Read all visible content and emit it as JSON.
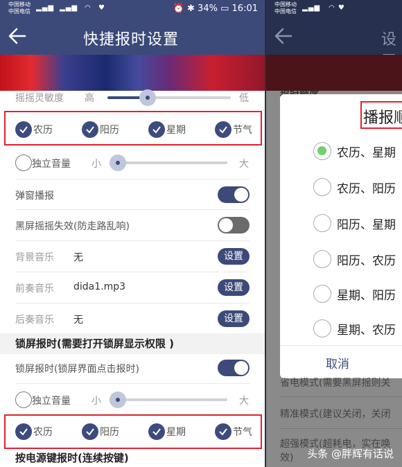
{
  "status_bar": {
    "carrier_top": "中国移动",
    "carrier_bottom": "中国电信",
    "net1": "2G",
    "net2": "4G",
    "battery": "34%",
    "time": "16:01"
  },
  "header": {
    "title": "快捷报时设置"
  },
  "settings": {
    "shake_sensitivity": {
      "label": "摇摇灵敏度",
      "high": "高",
      "low": "低",
      "level": 0.4
    },
    "broadcast_items": [
      "农历",
      "阳历",
      "星期",
      "节气"
    ],
    "independent_volume": {
      "label": "独立音量",
      "small": "小",
      "large": "大",
      "level": 0.02
    },
    "popup_broadcast": {
      "label": "弹窗播报",
      "on": true
    },
    "black_screen_shake": {
      "label": "黑屏摇摇失效(防走路乱响)",
      "on": false
    },
    "bg_music": {
      "label": "背景音乐",
      "value": "无",
      "button": "设置"
    },
    "intro_music": {
      "label": "前奏音乐",
      "value": "dida1.mp3",
      "button": "设置"
    },
    "outro_music": {
      "label": "后奏音乐",
      "value": "无",
      "button": "设置"
    },
    "lock_section": "锁屏报时(需要打开锁屏显示权限 )",
    "lock_broadcast": {
      "label": "锁屏报时(锁屏界面点击报时)",
      "on": true
    },
    "lock_volume": {
      "label": "独立音量",
      "small": "小",
      "large": "大",
      "level": 0.02
    },
    "lock_items": [
      "农历",
      "阳历",
      "星期",
      "节气"
    ],
    "power_section": "按电源键报时(连续按键)"
  },
  "dialog": {
    "title": "播报顺",
    "options": [
      "农历、星期",
      "农历、阳历",
      "阳历、星期",
      "阳历、农历",
      "星期、阳历",
      "星期、农历"
    ],
    "selected": 0,
    "cancel": "取消",
    "behind_header": "设置",
    "behind_label": "报时顺序"
  },
  "behind_rows": [
    "省电模式(需要黑屏摇则关",
    "精准模式(建议关闭，关闭",
    "超强模式(超耗电，实在唤",
    "效)"
  ],
  "watermark": "头条 @胖辉有话说",
  "colors": {
    "primary": "#3c4a79",
    "highlight": "#e3202d",
    "radio_selected": "#6fd06f"
  }
}
